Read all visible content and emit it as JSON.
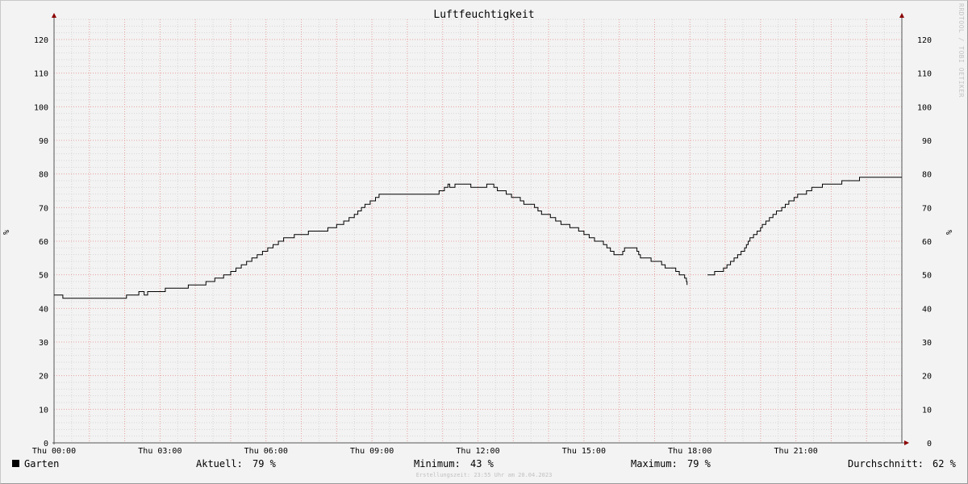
{
  "watermark": "RRDTOOL / TOBI OETIKER",
  "chart_data": {
    "type": "line",
    "title": "Luftfeuchtigkeit",
    "ylabel": "%",
    "ylim": [
      0,
      126
    ],
    "xlim_hours": [
      0,
      24
    ],
    "yticks": [
      0,
      10,
      20,
      30,
      40,
      50,
      60,
      70,
      80,
      90,
      100,
      110,
      120
    ],
    "xticks": [
      {
        "hour": 0,
        "label": "Thu 00:00"
      },
      {
        "hour": 3,
        "label": "Thu 03:00"
      },
      {
        "hour": 6,
        "label": "Thu 06:00"
      },
      {
        "hour": 9,
        "label": "Thu 09:00"
      },
      {
        "hour": 12,
        "label": "Thu 12:00"
      },
      {
        "hour": 15,
        "label": "Thu 15:00"
      },
      {
        "hour": 18,
        "label": "Thu 18:00"
      },
      {
        "hour": 21,
        "label": "Thu 21:00"
      }
    ],
    "grid": true,
    "series": [
      {
        "name": "Garten",
        "color": "#000000",
        "points": [
          [
            0.0,
            44
          ],
          [
            0.25,
            43
          ],
          [
            2.0,
            43
          ],
          [
            2.05,
            44
          ],
          [
            2.4,
            45
          ],
          [
            2.55,
            44
          ],
          [
            2.65,
            45
          ],
          [
            3.15,
            46
          ],
          [
            3.8,
            47
          ],
          [
            4.3,
            48
          ],
          [
            4.55,
            49
          ],
          [
            4.8,
            50
          ],
          [
            5.0,
            51
          ],
          [
            5.15,
            52
          ],
          [
            5.3,
            53
          ],
          [
            5.45,
            54
          ],
          [
            5.6,
            55
          ],
          [
            5.75,
            56
          ],
          [
            5.9,
            57
          ],
          [
            6.05,
            58
          ],
          [
            6.2,
            59
          ],
          [
            6.35,
            60
          ],
          [
            6.5,
            61
          ],
          [
            6.8,
            62
          ],
          [
            7.2,
            63
          ],
          [
            7.75,
            64
          ],
          [
            8.0,
            65
          ],
          [
            8.2,
            66
          ],
          [
            8.35,
            67
          ],
          [
            8.5,
            68
          ],
          [
            8.6,
            69
          ],
          [
            8.7,
            70
          ],
          [
            8.8,
            71
          ],
          [
            8.95,
            72
          ],
          [
            9.1,
            73
          ],
          [
            9.2,
            74
          ],
          [
            10.9,
            75
          ],
          [
            11.05,
            76
          ],
          [
            11.15,
            77
          ],
          [
            11.2,
            76
          ],
          [
            11.35,
            77
          ],
          [
            11.8,
            76
          ],
          [
            12.25,
            77
          ],
          [
            12.45,
            76
          ],
          [
            12.55,
            75
          ],
          [
            12.8,
            74
          ],
          [
            12.95,
            73
          ],
          [
            13.2,
            72
          ],
          [
            13.3,
            71
          ],
          [
            13.6,
            70
          ],
          [
            13.7,
            69
          ],
          [
            13.8,
            68
          ],
          [
            14.05,
            67
          ],
          [
            14.2,
            66
          ],
          [
            14.35,
            65
          ],
          [
            14.6,
            64
          ],
          [
            14.85,
            63
          ],
          [
            15.0,
            62
          ],
          [
            15.15,
            61
          ],
          [
            15.3,
            60
          ],
          [
            15.55,
            59
          ],
          [
            15.65,
            58
          ],
          [
            15.75,
            57
          ],
          [
            15.85,
            56
          ],
          [
            16.1,
            57
          ],
          [
            16.15,
            58
          ],
          [
            16.5,
            57
          ],
          [
            16.55,
            56
          ],
          [
            16.6,
            55
          ],
          [
            16.9,
            54
          ],
          [
            17.2,
            53
          ],
          [
            17.3,
            52
          ],
          [
            17.6,
            51
          ],
          [
            17.7,
            50
          ],
          [
            17.85,
            49
          ],
          [
            17.9,
            48
          ],
          [
            17.92,
            47
          ],
          null,
          [
            18.5,
            50
          ],
          [
            18.7,
            51
          ],
          [
            18.95,
            52
          ],
          [
            19.05,
            53
          ],
          [
            19.15,
            54
          ],
          [
            19.25,
            55
          ],
          [
            19.35,
            56
          ],
          [
            19.45,
            57
          ],
          [
            19.55,
            58
          ],
          [
            19.6,
            59
          ],
          [
            19.65,
            60
          ],
          [
            19.7,
            61
          ],
          [
            19.8,
            62
          ],
          [
            19.9,
            63
          ],
          [
            20.0,
            64
          ],
          [
            20.05,
            65
          ],
          [
            20.15,
            66
          ],
          [
            20.25,
            67
          ],
          [
            20.35,
            68
          ],
          [
            20.45,
            69
          ],
          [
            20.6,
            70
          ],
          [
            20.7,
            71
          ],
          [
            20.8,
            72
          ],
          [
            20.95,
            73
          ],
          [
            21.05,
            74
          ],
          [
            21.3,
            75
          ],
          [
            21.45,
            76
          ],
          [
            21.75,
            77
          ],
          [
            22.3,
            78
          ],
          [
            22.8,
            79
          ],
          [
            24.0,
            79
          ]
        ]
      }
    ]
  },
  "legend": {
    "series_name": "Garten",
    "current_label": "Aktuell:",
    "current_value": "79 %",
    "min_label": "Minimum:",
    "min_value": "43 %",
    "max_label": "Maximum:",
    "max_value": "79 %",
    "avg_label": "Durchschnitt:",
    "avg_value": "62 %"
  },
  "footer": "Erstellungszeit: 23:55 Uhr am 20.04.2023"
}
